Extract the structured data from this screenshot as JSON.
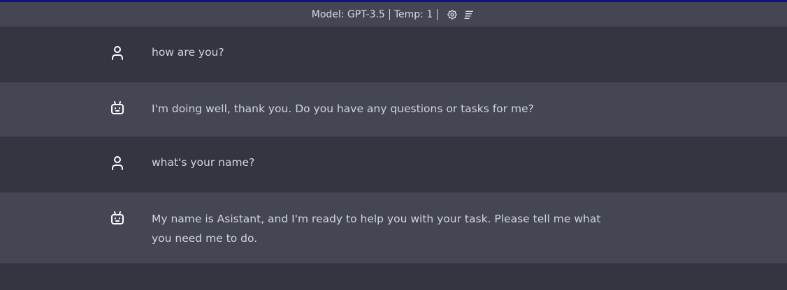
{
  "header": {
    "model_label": "Model: GPT-3.5",
    "temp_label": "Temp: 1",
    "settings_icon": "gear-icon",
    "menu_icon": "lines-menu-icon"
  },
  "messages": [
    {
      "role": "user",
      "icon": "user-icon",
      "text": "how are you?"
    },
    {
      "role": "assistant",
      "icon": "robot-icon",
      "text": "I'm doing well, thank you. Do you have any questions or tasks for me?"
    },
    {
      "role": "user",
      "icon": "user-icon",
      "text": "what's your name?"
    },
    {
      "role": "assistant",
      "icon": "robot-icon",
      "text": "My name is Asistant, and I'm ready to help you with your task. Please tell me what you need me to do."
    }
  ],
  "colors": {
    "accent_top_bar": "#13137a",
    "user_row_bg": "#343541",
    "assistant_row_bg": "#444654"
  }
}
